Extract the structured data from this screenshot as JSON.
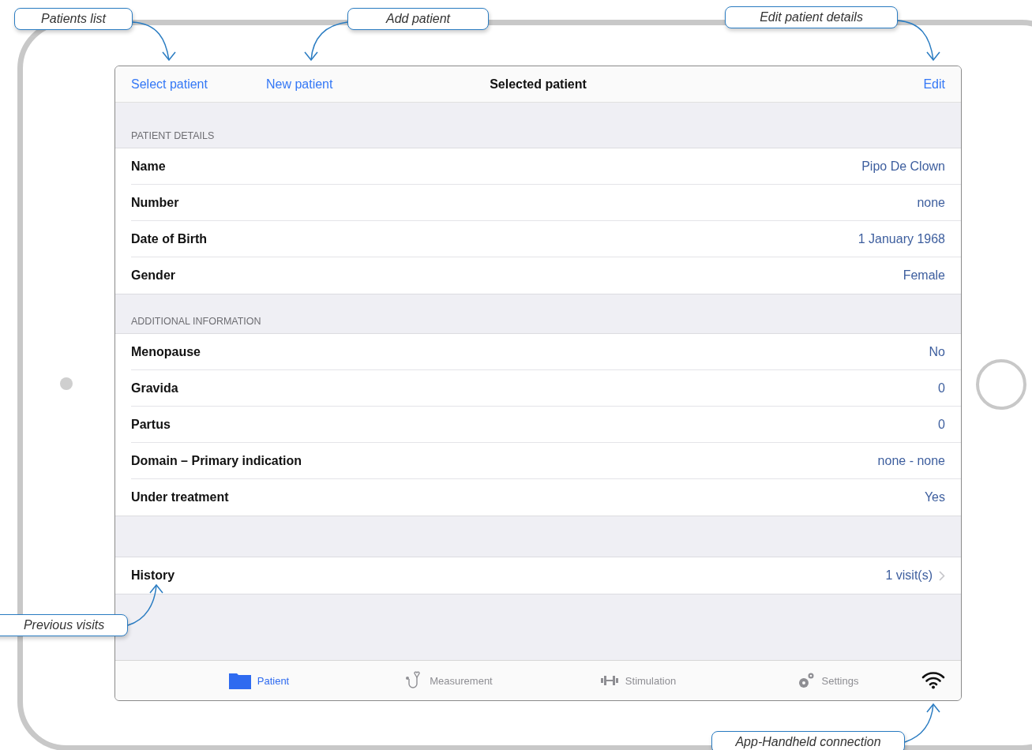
{
  "callouts": [
    {
      "text": "Patients list"
    },
    {
      "text": "Add patient"
    },
    {
      "text": "Edit patient details"
    },
    {
      "text": "Previous visits"
    },
    {
      "text": "App-Handheld connection"
    }
  ],
  "nav_bar": {
    "left_buttons": [
      "Select patient",
      "New patient"
    ],
    "title": "Selected patient",
    "right_button": "Edit"
  },
  "sections": [
    {
      "header": "PATIENT DETAILS",
      "rows": [
        {
          "label": "Name",
          "value": "Pipo De Clown"
        },
        {
          "label": "Number",
          "value": "none"
        },
        {
          "label": "Date of Birth",
          "value": "1 January 1968"
        },
        {
          "label": "Gender",
          "value": "Female"
        }
      ]
    },
    {
      "header": "ADDITIONAL INFORMATION",
      "rows": [
        {
          "label": "Menopause",
          "value": "No"
        },
        {
          "label": "Gravida",
          "value": "0"
        },
        {
          "label": "Partus",
          "value": "0"
        },
        {
          "label": "Domain – Primary indication",
          "value": "none - none"
        },
        {
          "label": "Under treatment",
          "value": "Yes"
        }
      ]
    }
  ],
  "history": {
    "label": "History",
    "value": "1 visit(s)"
  },
  "tab_bar": {
    "tabs": [
      {
        "label": "Patient",
        "kind": "folder",
        "selected": true
      },
      {
        "label": "Measurement",
        "kind": "stethoscope",
        "selected": false
      },
      {
        "label": "Stimulation",
        "kind": "dumbbell",
        "selected": false
      },
      {
        "label": "Settings",
        "kind": "gears",
        "selected": false
      }
    ]
  }
}
